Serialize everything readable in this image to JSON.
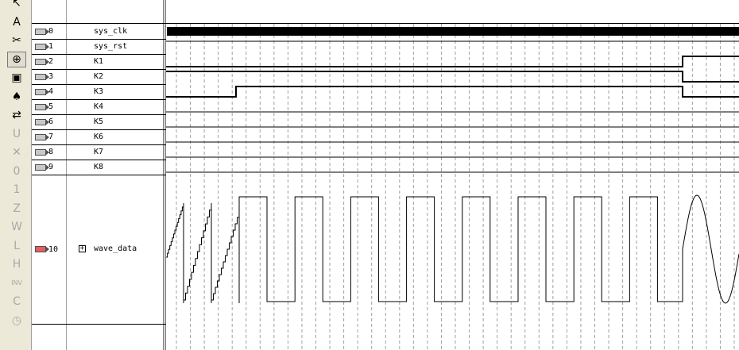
{
  "toolbar": {
    "tools": [
      "select-tool",
      "text-tool",
      "wave-edit-tool",
      "zoom-tool",
      "fullscreen-tool",
      "find-tool",
      "replace-tool",
      "uninit-tool",
      "forcing-unknown-tool",
      "forcing-low-tool",
      "forcing-high-tool",
      "high-impedance-tool",
      "weak-unknown-tool",
      "weak-low-tool",
      "weak-high-tool",
      "invert-tool",
      "count-value-tool",
      "clock-tool"
    ]
  },
  "signals": [
    {
      "index": "0",
      "name": "sys_clk"
    },
    {
      "index": "1",
      "name": "sys_rst"
    },
    {
      "index": "2",
      "name": "K1"
    },
    {
      "index": "3",
      "name": "K2"
    },
    {
      "index": "4",
      "name": "K3"
    },
    {
      "index": "5",
      "name": "K4"
    },
    {
      "index": "6",
      "name": "K5"
    },
    {
      "index": "7",
      "name": "K6"
    },
    {
      "index": "8",
      "name": "K7"
    },
    {
      "index": "9",
      "name": "K8"
    },
    {
      "index": "10",
      "name": "wave_data",
      "bus": true,
      "expand": "+"
    }
  ],
  "waves": {
    "sys_clk": "clock",
    "sys_rst": "high",
    "K1": {
      "type": "low",
      "rise_at": 650
    },
    "K2": {
      "type": "high",
      "fall_at": 650
    },
    "K3": {
      "type": "pulse",
      "rise_at": 88,
      "fall_at": 650
    },
    "wave_data": {
      "segments": [
        "sawtooth",
        "sawtooth",
        "sawtooth",
        "square",
        "square",
        "square",
        "square",
        "square",
        "square",
        "square",
        "square",
        "sine"
      ]
    }
  },
  "colors": {
    "grid": "#a0a0a0",
    "wave": "#000000",
    "toolbar_bg": "#ece9d8",
    "bus_pin": "#e06060"
  }
}
